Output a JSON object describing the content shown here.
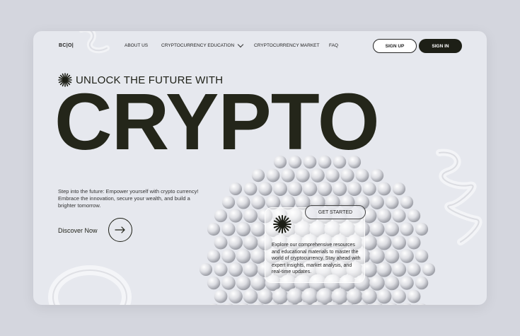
{
  "nav": {
    "logo": "BC|O|",
    "links": [
      "ABOUT US",
      "CRYPTOCURRENCY EDUCATION",
      "CRYPTOCURRENCY MARKET",
      "FAQ"
    ],
    "signup_label": "SIGN UP",
    "signin_label": "SIGN IN"
  },
  "hero": {
    "tagline": "UNLOCK THE FUTURE WITH",
    "title": "CRYPTO",
    "description": "Step into the future: Empower yourself with crypto currency! Embrace the innovation, secure your wealth, and build a brighter tomorrow.",
    "cta_label": "Discover Now",
    "get_started_label": "GET STARTED",
    "card_text": "Explore our comprehensive resources and educational materials to master the world of cryptocurrency. Stay ahead with expert insights, market analysis, and real-time updates."
  },
  "colors": {
    "background": "#d4d6de",
    "card": "#e6e8ee",
    "dark": "#1d1f16"
  },
  "icons": [
    "starburst-icon",
    "chevron-down-icon",
    "arrow-right-icon"
  ]
}
